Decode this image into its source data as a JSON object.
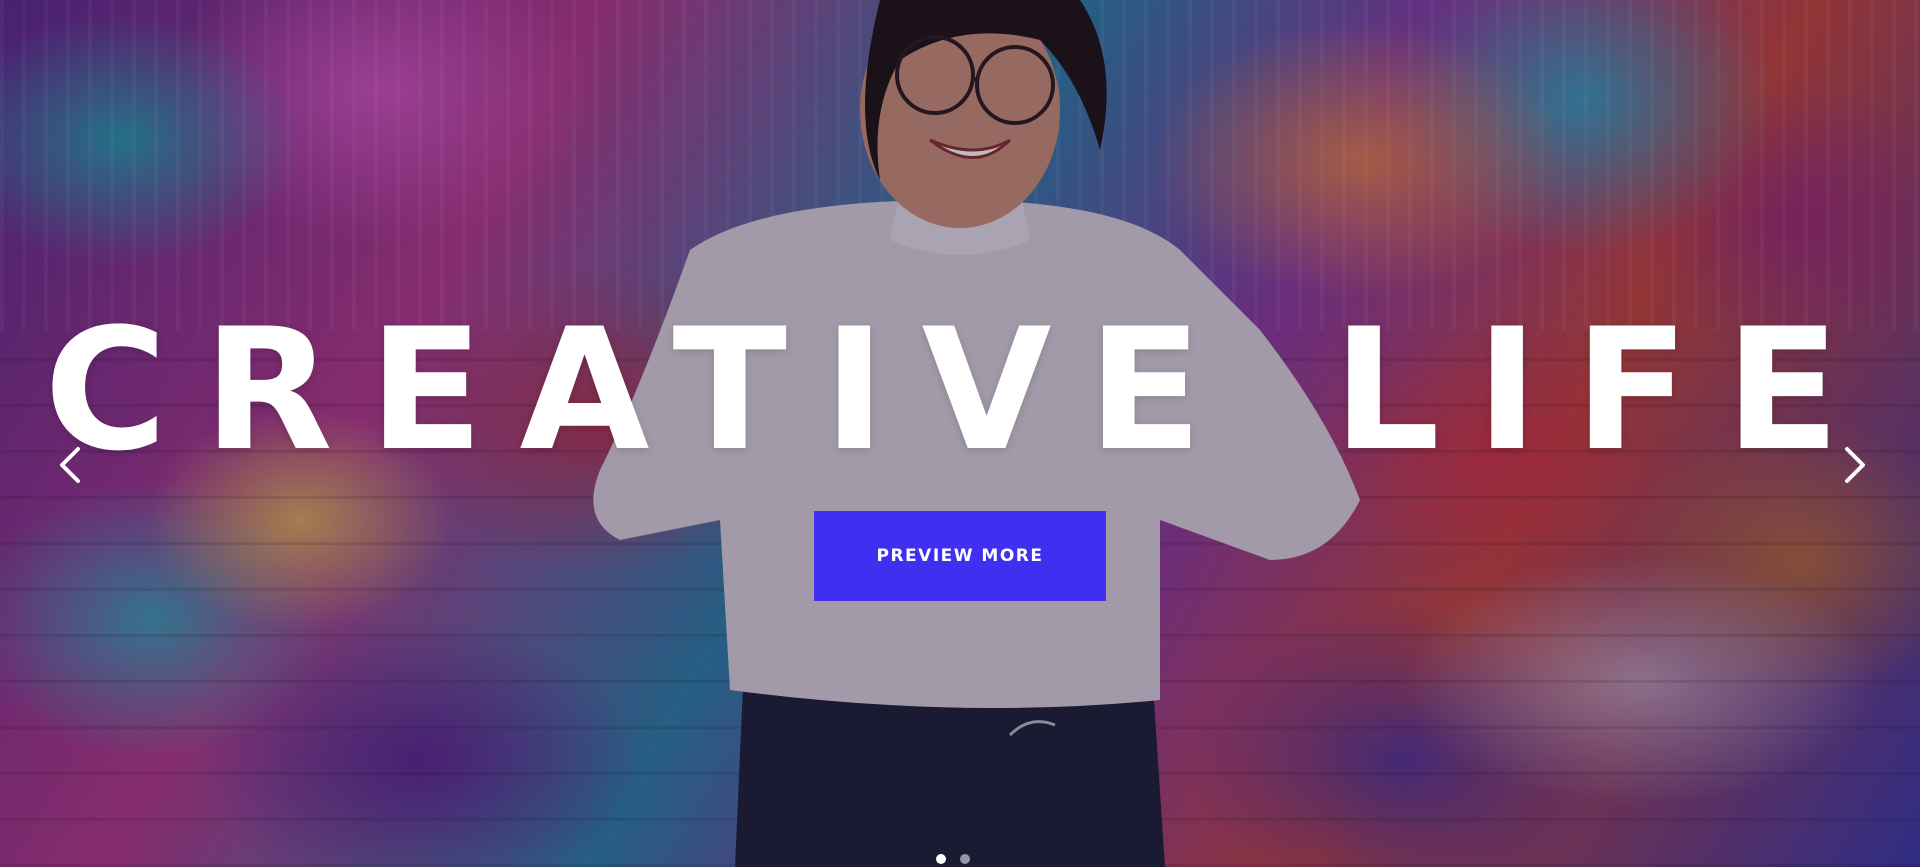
{
  "slider": {
    "headline": "CREATIVE LIFE",
    "cta_label": "PREVIEW MORE",
    "prev_icon": "chevron-left-icon",
    "next_icon": "chevron-right-icon",
    "slide_count": 2,
    "active_slide": 1
  },
  "colors": {
    "cta_background": "#3f2ff0",
    "headline": "#ffffff"
  }
}
